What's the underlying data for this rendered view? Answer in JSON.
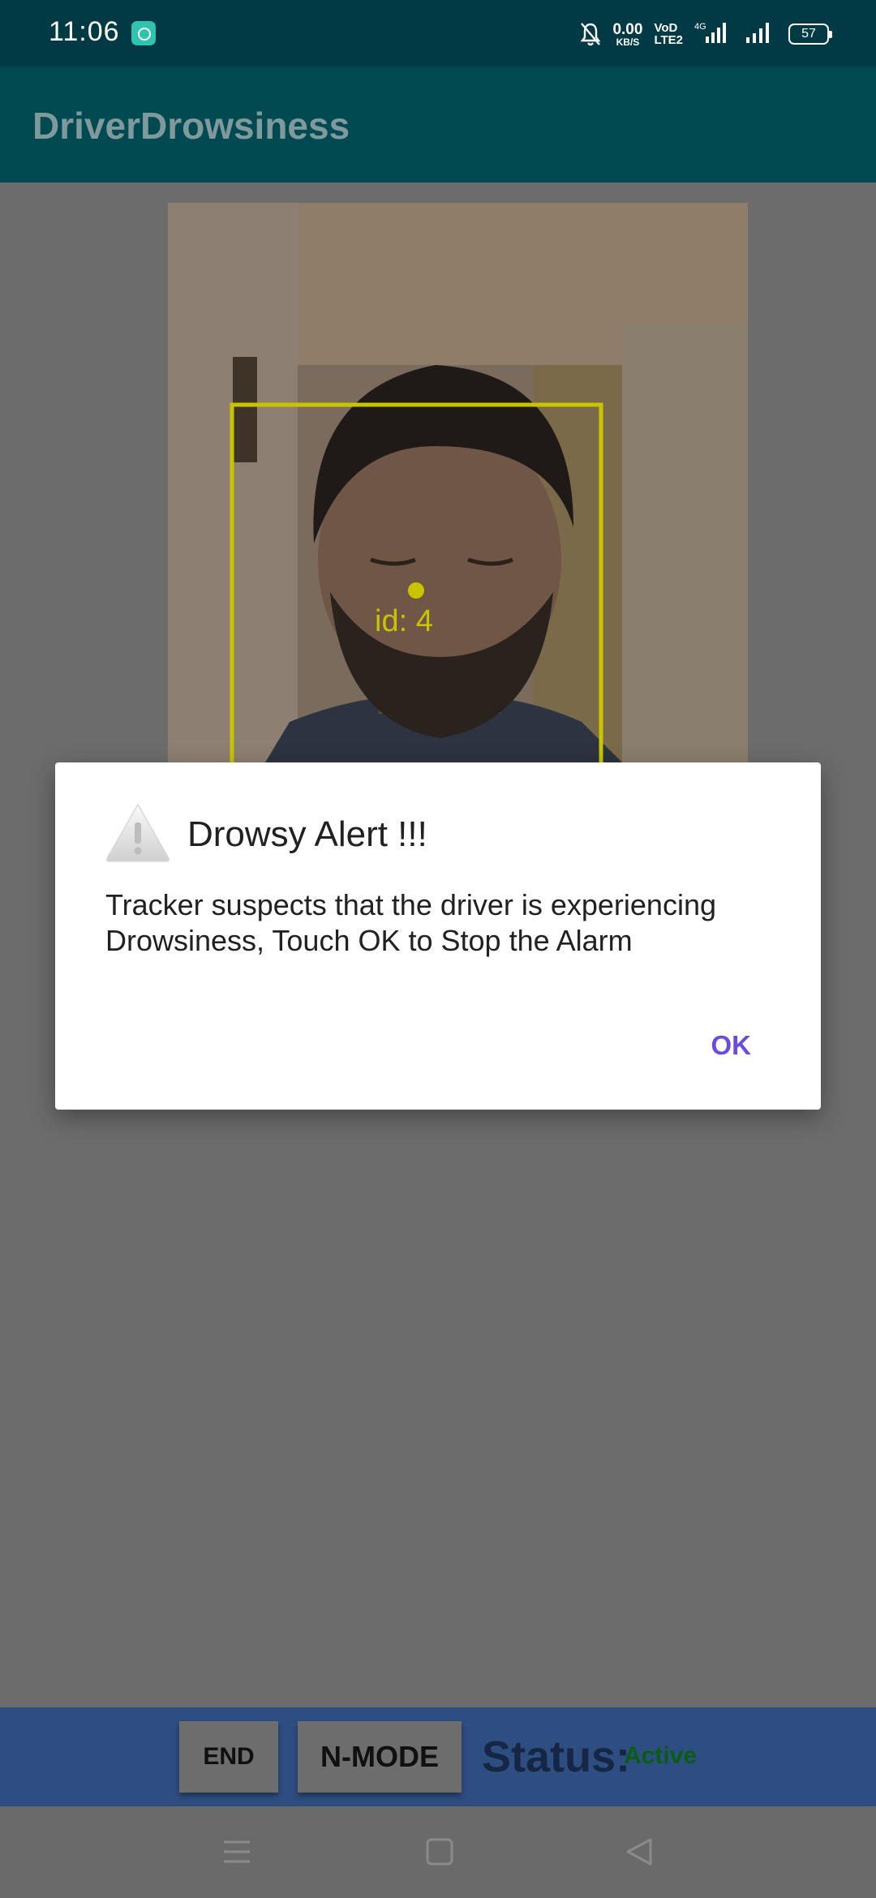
{
  "status_bar": {
    "time": "11:06",
    "net_speed_value": "0.00",
    "net_speed_unit": "KB/S",
    "volte_line1": "VoD",
    "volte_line2": "LTE2",
    "network_type": "4G",
    "battery": "57"
  },
  "app_bar": {
    "title": "DriverDrowsiness"
  },
  "camera": {
    "face_id_label": "id: 4",
    "overlay_color": "#c9c400"
  },
  "dialog": {
    "icon": "warning-icon",
    "title": "Drowsy Alert !!!",
    "message": "Tracker suspects that the driver is experiencing Drowsiness, Touch OK to Stop the Alarm",
    "ok_label": "OK"
  },
  "controls": {
    "end_label": "END",
    "nmode_label": "N-MODE",
    "status_label": "Status:",
    "status_value": "Active",
    "status_value_color": "#0a5c14"
  },
  "nav": {
    "menu_icon": "menu-icon",
    "home_icon": "home-icon",
    "back_icon": "back-icon"
  }
}
